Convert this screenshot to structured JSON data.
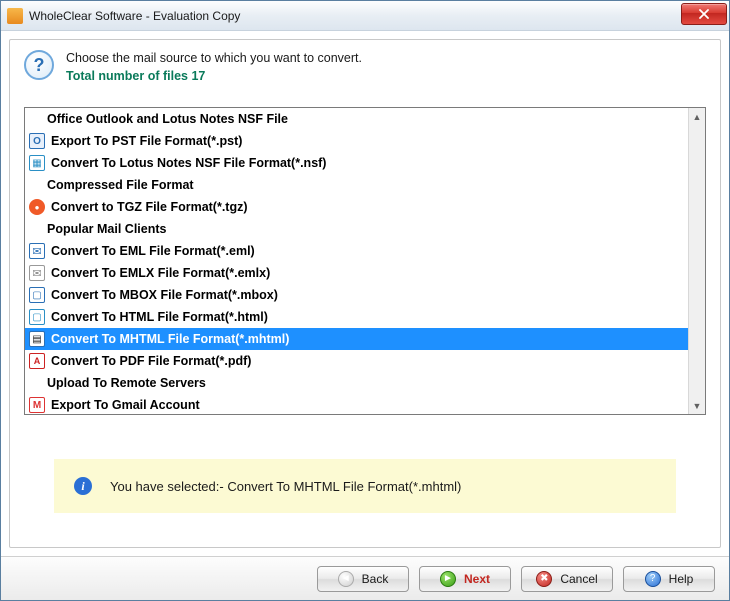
{
  "window": {
    "title": "WholeClear Software - Evaluation Copy"
  },
  "instruction": {
    "line1": "Choose the mail source to which you want to convert.",
    "line2": "Total number of files 17"
  },
  "groups": [
    {
      "type": "header",
      "label": "Office Outlook and Lotus Notes NSF File"
    },
    {
      "type": "item",
      "label": "Export To PST File Format(*.pst)",
      "icon": "ic-pst",
      "selected": false
    },
    {
      "type": "item",
      "label": "Convert To Lotus Notes NSF File Format(*.nsf)",
      "icon": "ic-nsf",
      "selected": false
    },
    {
      "type": "header",
      "label": "Compressed File Format"
    },
    {
      "type": "item",
      "label": "Convert to TGZ File Format(*.tgz)",
      "icon": "ic-tgz",
      "selected": false
    },
    {
      "type": "header",
      "label": "Popular Mail Clients"
    },
    {
      "type": "item",
      "label": "Convert To EML File Format(*.eml)",
      "icon": "ic-eml",
      "selected": false
    },
    {
      "type": "item",
      "label": "Convert To EMLX File Format(*.emlx)",
      "icon": "ic-emlx",
      "selected": false
    },
    {
      "type": "item",
      "label": "Convert To MBOX File Format(*.mbox)",
      "icon": "ic-mbox",
      "selected": false
    },
    {
      "type": "item",
      "label": "Convert To HTML File Format(*.html)",
      "icon": "ic-html",
      "selected": false
    },
    {
      "type": "item",
      "label": "Convert To MHTML File Format(*.mhtml)",
      "icon": "ic-mhtml",
      "selected": true
    },
    {
      "type": "item",
      "label": "Convert To PDF File Format(*.pdf)",
      "icon": "ic-pdf",
      "selected": false
    },
    {
      "type": "header",
      "label": "Upload To Remote Servers"
    },
    {
      "type": "item",
      "label": "Export To Gmail Account",
      "icon": "ic-gmail",
      "selected": false
    }
  ],
  "notice": {
    "prefix": "You have selected:- ",
    "value": "Convert To MHTML File Format(*.mhtml)"
  },
  "buttons": {
    "back": "Back",
    "next": "Next",
    "cancel": "Cancel",
    "help": "Help"
  }
}
